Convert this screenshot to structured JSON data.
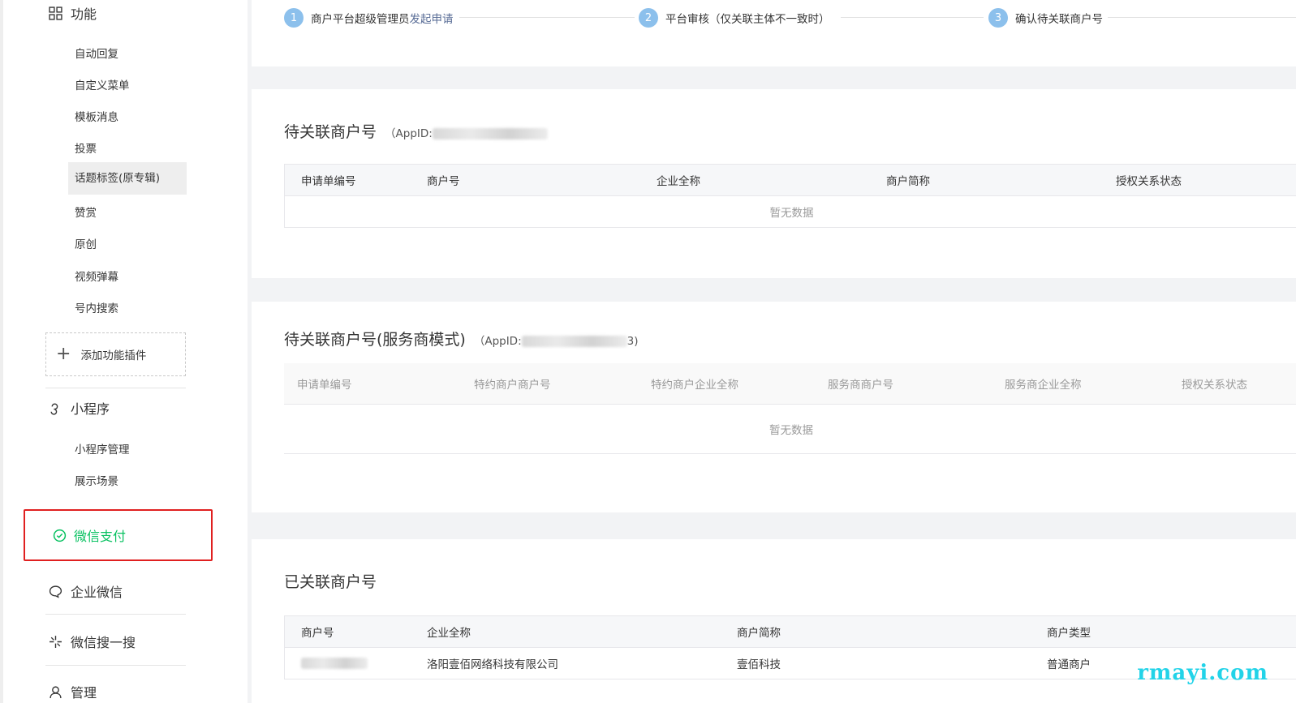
{
  "sidebar": {
    "group_function": "功能",
    "function_items": [
      "自动回复",
      "自定义菜单",
      "模板消息",
      "投票",
      "话题标签(原专辑)",
      "赞赏",
      "原创",
      "视频弹幕",
      "号内搜索"
    ],
    "add_plugin": "添加功能插件",
    "group_miniprogram": "小程序",
    "miniprogram_items": [
      "小程序管理",
      "展示场景"
    ],
    "wechat_pay": "微信支付",
    "wework": "企业微信",
    "search": "微信搜一搜",
    "manage": "管理"
  },
  "steps": {
    "step1_num": "1",
    "step1_text": "商户平台超级管理员",
    "step1_link": "发起申请",
    "step2_num": "2",
    "step2_text": "平台审核（仅关联主体不一致时）",
    "step3_num": "3",
    "step3_text": "确认待关联商户号"
  },
  "pending": {
    "title": "待关联商户号",
    "appid_prefix": "（AppID:",
    "columns": [
      "申请单编号",
      "商户号",
      "企业全称",
      "商户简称",
      "授权关系状态"
    ],
    "empty": "暂无数据"
  },
  "pending_sp": {
    "title": "待关联商户号(服务商模式)",
    "appid_prefix": "（AppID:",
    "appid_suffix": "3)",
    "columns": [
      "申请单编号",
      "特约商户商户号",
      "特约商户企业全称",
      "服务商商户号",
      "服务商企业全称",
      "授权关系状态"
    ],
    "empty": "暂无数据"
  },
  "linked": {
    "title": "已关联商户号",
    "columns": [
      "商户号",
      "企业全称",
      "商户简称",
      "商户类型"
    ],
    "rows": [
      {
        "company": "洛阳壹佰网络科技有限公司",
        "short": "壹佰科技",
        "type": "普通商户"
      }
    ]
  },
  "watermark": "rmayi.com"
}
